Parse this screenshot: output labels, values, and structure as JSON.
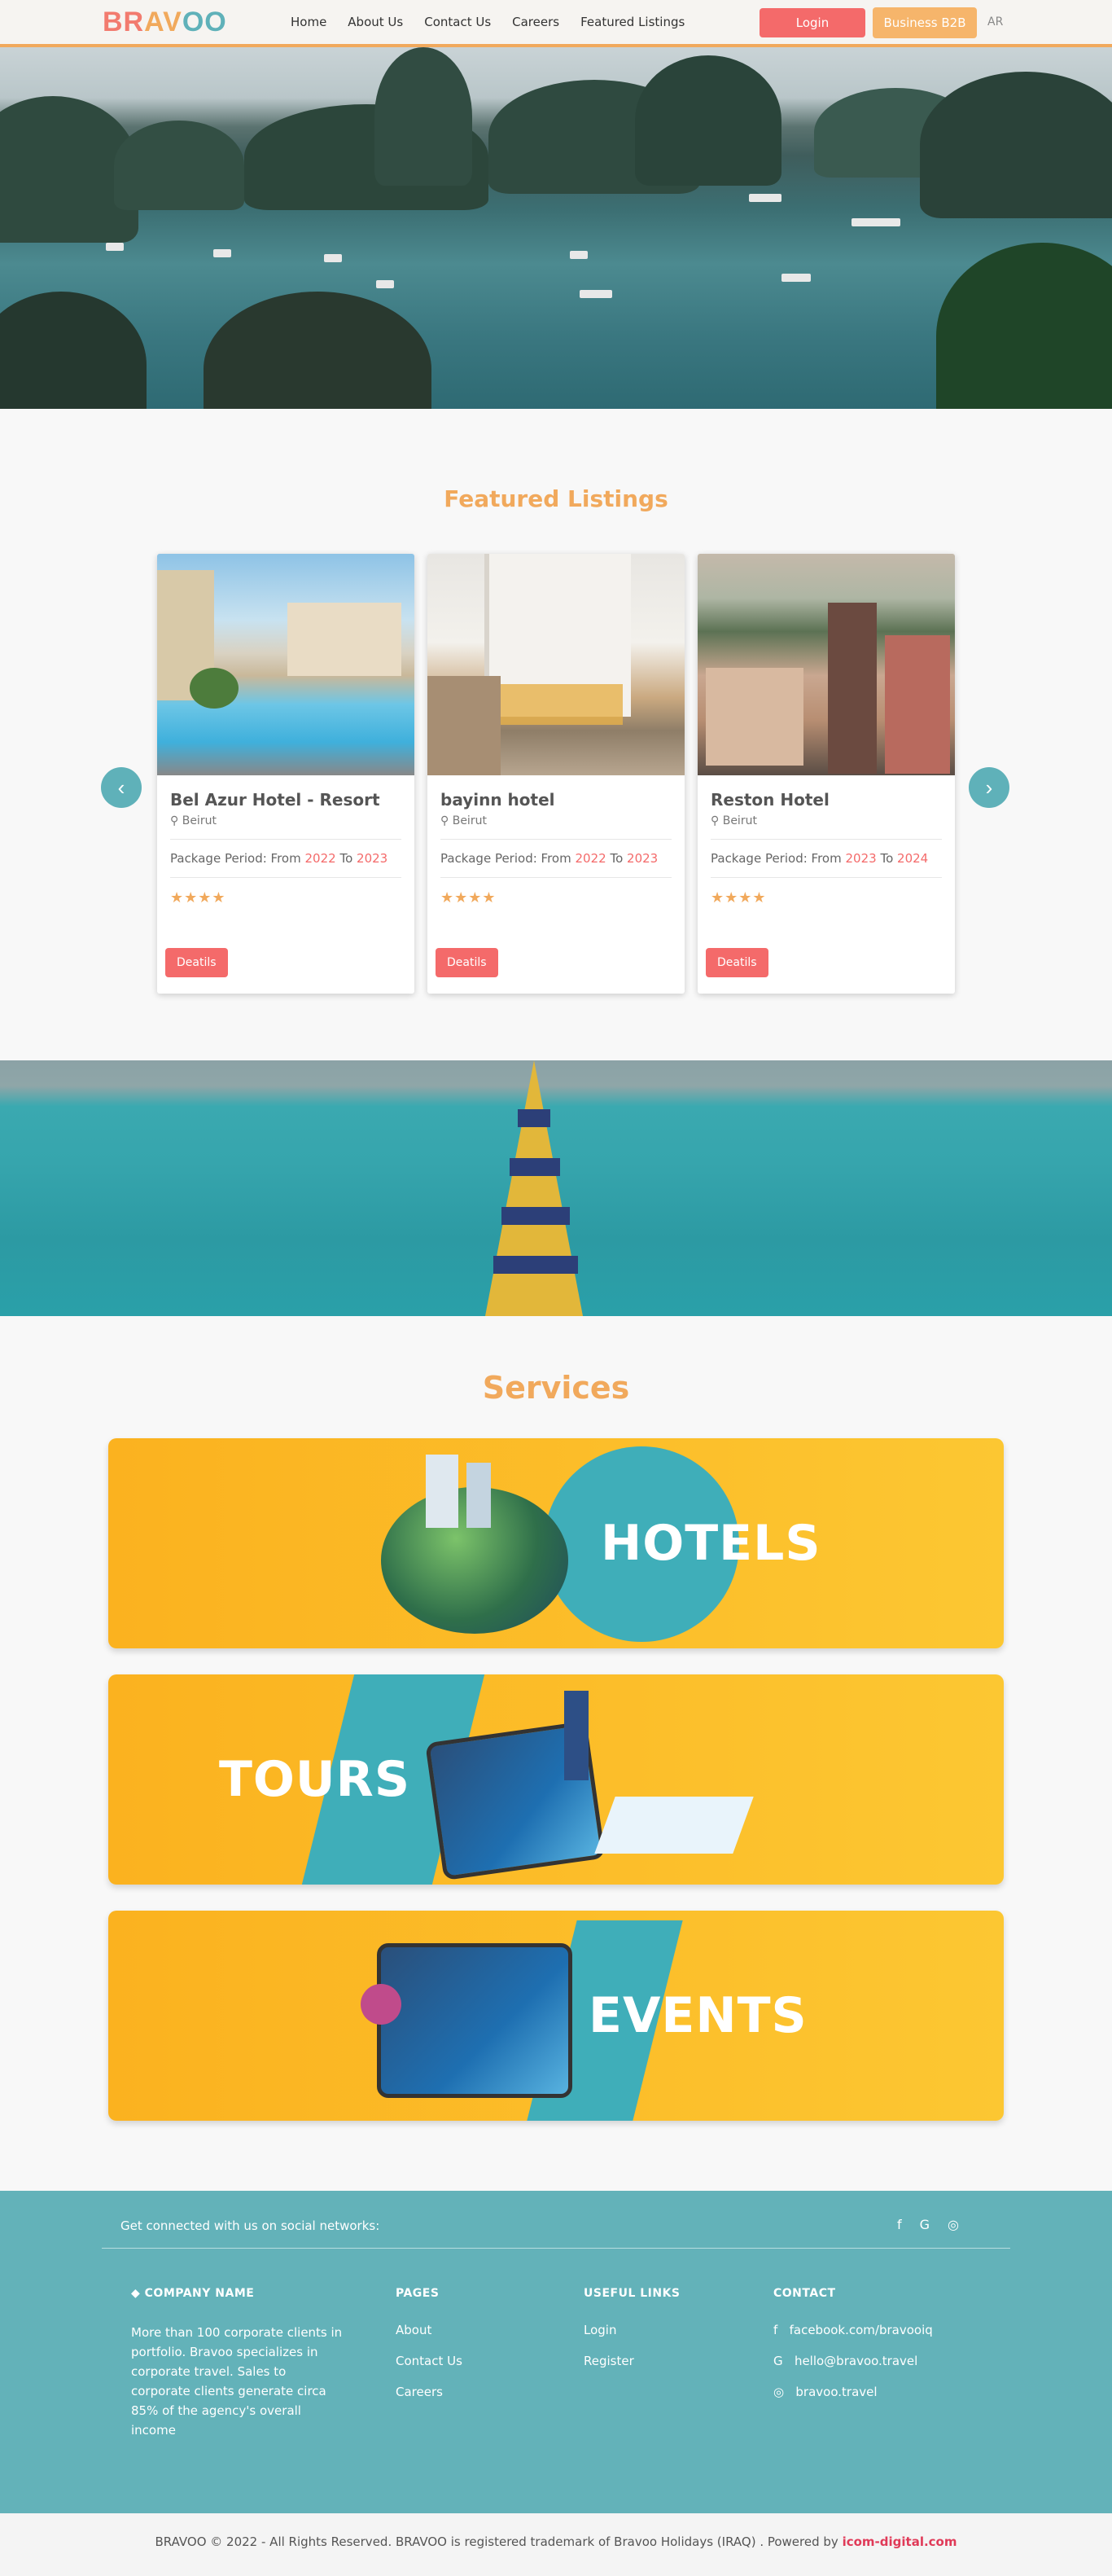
{
  "brand": {
    "logo_part1": "BR",
    "logo_part2": "AV",
    "logo_part3": "OO"
  },
  "nav": {
    "items": [
      "Home",
      "About Us",
      "Contact Us",
      "Careers",
      "Featured Listings"
    ],
    "login_label": "Login",
    "b2b_label": "Business B2B",
    "lang_label": "AR"
  },
  "featured": {
    "title": "Featured Listings",
    "prev_icon": "‹",
    "next_icon": "›",
    "period_label": "Package Period: From",
    "to_label": "To",
    "details_label": "Deatils",
    "cards": [
      {
        "name": "Bel Azur Hotel - Resort",
        "location": "Beirut",
        "from": "2022",
        "to": "2023",
        "stars": "★★★★"
      },
      {
        "name": "bayinn hotel",
        "location": "Beirut",
        "from": "2022",
        "to": "2023",
        "stars": "★★★★"
      },
      {
        "name": "Reston Hotel",
        "location": "Beirut",
        "from": "2023",
        "to": "2024",
        "stars": "★★★★"
      }
    ]
  },
  "services": {
    "title": "Services",
    "items": [
      "HOTELS",
      "TOURS",
      "EVENTS"
    ]
  },
  "footer": {
    "social_text": "Get connected with us on social networks:",
    "social_icons": [
      "f",
      "G",
      "◎"
    ],
    "company_heading": "COMPANY NAME",
    "company_text": "More than 100 corporate clients in portfolio. Bravoo specializes in corporate travel. Sales to corporate clients generate circa 85% of the agency's overall income",
    "pages_heading": "PAGES",
    "pages": [
      "About",
      "Contact Us",
      "Careers"
    ],
    "useful_heading": "USEFUL LINKS",
    "useful": [
      "Login",
      "Register"
    ],
    "contact_heading": "CONTACT",
    "contacts": [
      "facebook.com/bravooiq",
      "hello@bravoo.travel",
      "bravoo.travel"
    ],
    "contact_icons": [
      "f",
      "G",
      "◎"
    ]
  },
  "copyright": {
    "text": "BRAVOO © 2022 - All Rights Reserved. BRAVOO is registered trademark of Bravoo Holidays (IRAQ) . Powered by",
    "powered": "icom-digital.com"
  }
}
